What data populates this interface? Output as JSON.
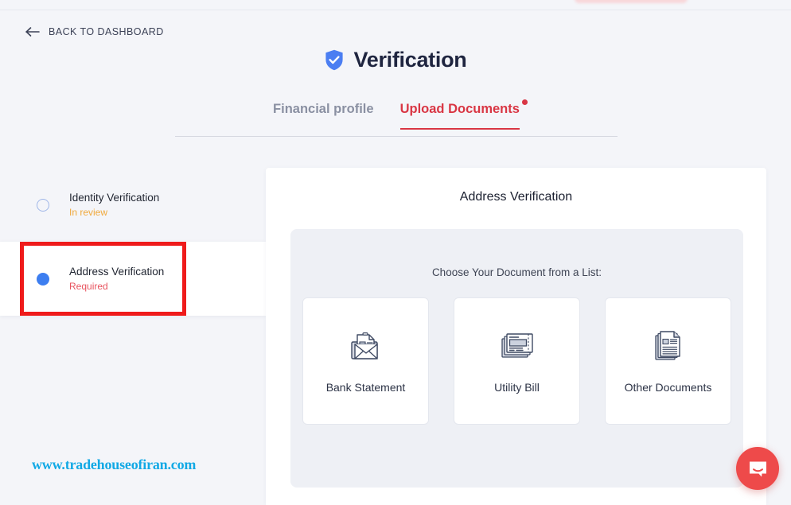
{
  "header": {
    "back_label": "BACK TO DASHBOARD",
    "back_icon": "arrow-left-icon",
    "title": "Verification",
    "title_icon": "shield-check-icon",
    "accent_blue": "#3d7ef0",
    "title_color": "#1f2540"
  },
  "tabs": {
    "items": [
      {
        "label": "Financial profile",
        "active": false,
        "badge": false
      },
      {
        "label": "Upload Documents",
        "active": true,
        "badge": true
      }
    ],
    "active_color": "#d93644",
    "inactive_color": "#8a90a2"
  },
  "sidebar": {
    "items": [
      {
        "title": "Identity Verification",
        "status": "In review",
        "status_color": "#f0a93c",
        "bullet": "circle-outline-icon",
        "selected": false
      },
      {
        "title": "Address Verification",
        "status": "Required",
        "status_color": "#e8545f",
        "bullet": "circle-filled-icon",
        "selected": true
      }
    ],
    "highlight_color": "#ef1b1b"
  },
  "main": {
    "heading": "Address Verification",
    "choose_label": "Choose Your Document from a List:",
    "documents": [
      {
        "label": "Bank Statement",
        "icon": "envelope-document-icon"
      },
      {
        "label": "Utility Bill",
        "icon": "stacked-bill-icon"
      },
      {
        "label": "Other Documents",
        "icon": "stacked-documents-icon"
      }
    ]
  },
  "watermark": {
    "text": "www.tradehouseofiran.com",
    "color": "#12a9e5"
  },
  "chat": {
    "icon": "chat-bubble-smile-icon",
    "color": "#ee4a4a"
  }
}
